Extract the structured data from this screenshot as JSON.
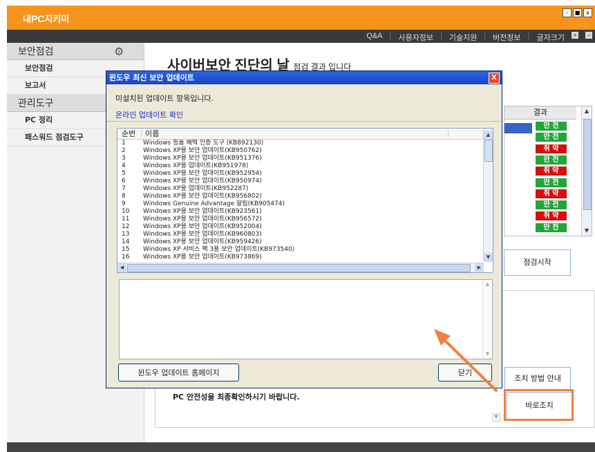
{
  "app": {
    "brand_prefix": "내",
    "brand_pc": "PC",
    "brand_suffix": "지키미"
  },
  "menu": {
    "items": [
      "Q&A",
      "사용자정보",
      "기술지원",
      "버전정보",
      "글자크기"
    ],
    "fontsize_plus": "+",
    "fontsize_minus": "−"
  },
  "window_buttons": {
    "minimize": "-",
    "maximize": "■",
    "close": "x"
  },
  "sidebar": {
    "sections": [
      {
        "header": "보안점검",
        "icon": "gear-icon",
        "items": [
          "보안점검",
          "보고서"
        ]
      },
      {
        "header": "관리도구",
        "items": [
          "PC 정리",
          "패스워드 점검도구"
        ]
      }
    ]
  },
  "main": {
    "title": "사이버보안 진단의 날",
    "title_tail": "점검 결과 입니다",
    "result_header": "결과",
    "results": [
      {
        "label": "안 전",
        "status": "safe"
      },
      {
        "label": "안 전",
        "status": "safe"
      },
      {
        "label": "취 약",
        "status": "weak"
      },
      {
        "label": "안 전",
        "status": "safe"
      },
      {
        "label": "취 약",
        "status": "weak"
      },
      {
        "label": "안 전",
        "status": "safe"
      },
      {
        "label": "취 약",
        "status": "weak"
      },
      {
        "label": "안 전",
        "status": "safe"
      },
      {
        "label": "취 약",
        "status": "weak"
      },
      {
        "label": "안 전",
        "status": "safe"
      }
    ],
    "start_button": "점검시작",
    "guide_button": "조치 방법 안내",
    "fix_button": "바로조치",
    "notice": "PC 안전성을 최종확인하시기 바랍니다."
  },
  "dialog": {
    "title": "윈도우 최신 보안 업데이트",
    "close": "X",
    "subtitle": "미설치된 업데이트 항목입니다.",
    "link": "온라인 업데이트 확인",
    "col_num": "순번",
    "col_name": "이름",
    "rows": [
      {
        "n": "1",
        "t": "Windows 정품 혜택 인증 도구 (KB892130)"
      },
      {
        "n": "2",
        "t": "Windows XP용 보안 업데이트(KB950762)"
      },
      {
        "n": "3",
        "t": "Windows XP용 보안 업데이트(KB951376)"
      },
      {
        "n": "4",
        "t": "Windows XP용 업데이트(KB951978)"
      },
      {
        "n": "5",
        "t": "Windows XP용 보안 업데이트(KB952954)"
      },
      {
        "n": "6",
        "t": "Windows XP용 보안 업데이트(KB950974)"
      },
      {
        "n": "7",
        "t": "Windows XP용 업데이트(KB952287)"
      },
      {
        "n": "8",
        "t": "Windows XP용 보안 업데이트(KB956802)"
      },
      {
        "n": "9",
        "t": "Windows Genuine Advantage 알림(KB905474)"
      },
      {
        "n": "10",
        "t": "Windows XP용 보안 업데이트(KB923561)"
      },
      {
        "n": "11",
        "t": "Windows XP용 보안 업데이트(KB956572)"
      },
      {
        "n": "12",
        "t": "Windows XP용 보안 업데이트(KB952004)"
      },
      {
        "n": "13",
        "t": "Windows XP용 보안 업데이트(KB960803)"
      },
      {
        "n": "14",
        "t": "Windows XP용 보안 업데이트(KB959426)"
      },
      {
        "n": "15",
        "t": "Windows XP 서비스 팩 3용 보안 업데이트(KB973540)"
      },
      {
        "n": "16",
        "t": "Windows XP용 보안 업데이트(KB973869)"
      }
    ],
    "homepage_button": "윈도우 업데이트 홈페이지",
    "close_button": "닫기"
  },
  "colors": {
    "brand_orange": "#f7941e",
    "safe_green": "#22a63a",
    "weak_red": "#d40f0f",
    "highlight_arrow": "#f07f3c",
    "titlebar_blue": "#1a47c4"
  }
}
